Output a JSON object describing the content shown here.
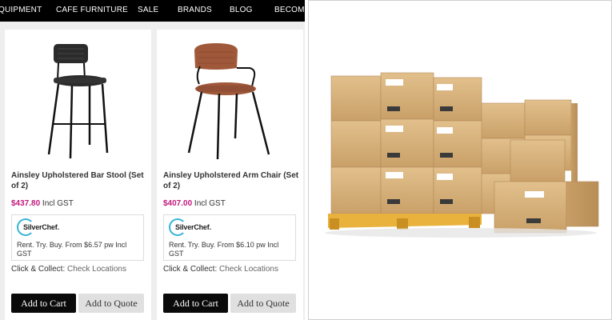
{
  "nav": {
    "items": [
      "QUIPMENT",
      "CAFE FURNITURE",
      "SALE",
      "BRANDS",
      "BLOG",
      "BECOME"
    ]
  },
  "products": [
    {
      "title": "Ainsley Upholstered Bar Stool (Set of 2)",
      "price": "$437.80",
      "price_suffix": " Incl GST",
      "silverchef_logo": "SilverChef.",
      "silverchef_text": "Rent. Try. Buy. From $6.57 pw Incl GST",
      "collect_label": "Click & Collect: ",
      "collect_link": "Check Locations",
      "cart_label": "Add to Cart",
      "quote_label": "Add to Quote",
      "seat_color": "#2b2b2b"
    },
    {
      "title": "Ainsley Upholstered Arm Chair (Set of 2)",
      "price": "$407.00",
      "price_suffix": " Incl GST",
      "silverchef_logo": "SilverChef.",
      "silverchef_text": "Rent. Try. Buy. From $6.10 pw Incl GST",
      "collect_label": "Click & Collect: ",
      "collect_link": "Check Locations",
      "cart_label": "Add to Cart",
      "quote_label": "Add to Quote",
      "seat_color": "#a0583a"
    }
  ],
  "colors": {
    "price": "#c2187a",
    "silverchef_ring": "#34b4d8",
    "box": "#d9b27a",
    "pallet": "#e8b23c"
  }
}
